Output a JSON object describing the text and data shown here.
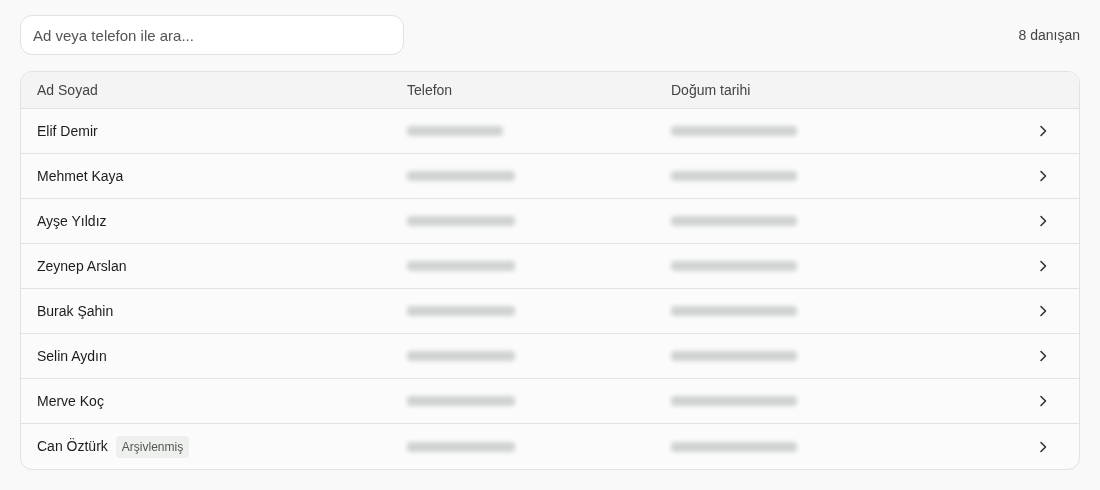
{
  "search": {
    "placeholder": "Ad veya telefon ile ara..."
  },
  "count": "8 danışan",
  "table": {
    "columns": [
      "Ad Soyad",
      "Telefon",
      "Doğum tarihi"
    ],
    "rows": [
      {
        "name": "Elif Demir"
      },
      {
        "name": "Mehmet Kaya"
      },
      {
        "name": "Ayşe Yıldız"
      },
      {
        "name": "Zeynep Arslan"
      },
      {
        "name": "Burak Şahin"
      },
      {
        "name": "Selin Aydın"
      },
      {
        "name": "Merve Koç"
      },
      {
        "name": "Can Öztürk",
        "badge": "Arşivlenmiş"
      }
    ]
  }
}
